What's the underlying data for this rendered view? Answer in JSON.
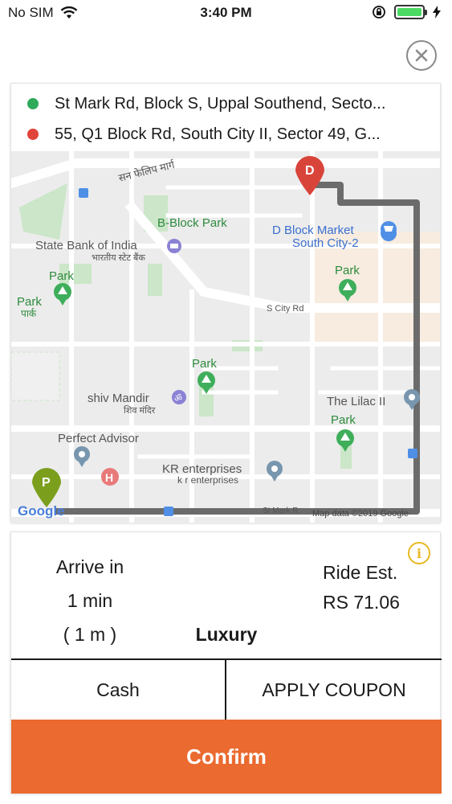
{
  "status_bar": {
    "carrier": "No SIM",
    "time": "3:40 PM",
    "battery_color": "#4cd964"
  },
  "icons": {
    "close": "close-icon",
    "wifi": "wifi-icon",
    "info": "info-icon"
  },
  "route": {
    "pickup_address": "St Mark Rd, Block S, Uppal Southend, Secto...",
    "drop_address": "55, Q1 Block Rd, South City II, Sector 49, G...",
    "pickup_color": "#2eaa5a",
    "drop_color": "#e0443a"
  },
  "map": {
    "labels": {
      "road_hindi": "सन फेलिप मार्ग",
      "b_block_park": "B-Block Park",
      "d_block_market": "D Block Market",
      "south_city_2": "South City-2",
      "sbi": "State Bank of India",
      "sbi_hindi": "भारतीय स्टेट बैंक",
      "park": "Park",
      "park_hindi": "पार्क",
      "s_city_rd": "S City Rd",
      "the_lilac": "The Lilac II",
      "shiv_mandir": "shiv Mandir",
      "shiv_mandir_hindi": "शिव मंदिर",
      "perfect_advisor": "Perfect Advisor",
      "kr_enterprises": "KR enterprises",
      "kr_enterprises_lower": "k r enterprises",
      "st_mark_rd": "St Mark R",
      "map_data": "Map data ©2019 Google",
      "google": "Google"
    },
    "marker_pickup": "P",
    "marker_drop": "D",
    "marker_hospital": "H",
    "route_color": "#6b6b6b"
  },
  "ride": {
    "arrive_label": "Arrive in",
    "arrive_time": "1 min",
    "arrive_distance": "( 1 m )",
    "est_label": "Ride Est.",
    "est_value": "RS 71.06",
    "vehicle_type": "Luxury"
  },
  "actions": {
    "payment": "Cash",
    "coupon": "APPLY COUPON",
    "confirm": "Confirm",
    "confirm_color": "#ea6a2f"
  }
}
